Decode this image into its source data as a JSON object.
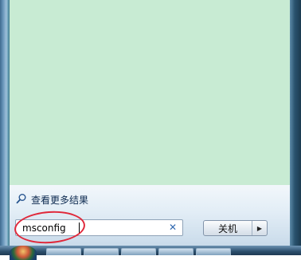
{
  "start_menu": {
    "search_more_label": "查看更多结果",
    "search_input": {
      "value": "msconfig",
      "clear_icon": "clear-icon",
      "placeholder": ""
    },
    "shutdown": {
      "label": "关机",
      "arrow_glyph": "▶"
    },
    "colors": {
      "programs_panel": "#c8ebd3",
      "highlight_circle": "#e0283a"
    }
  },
  "taskbar": {
    "start_icon": "windows-orb-icon",
    "button_count": 5
  }
}
